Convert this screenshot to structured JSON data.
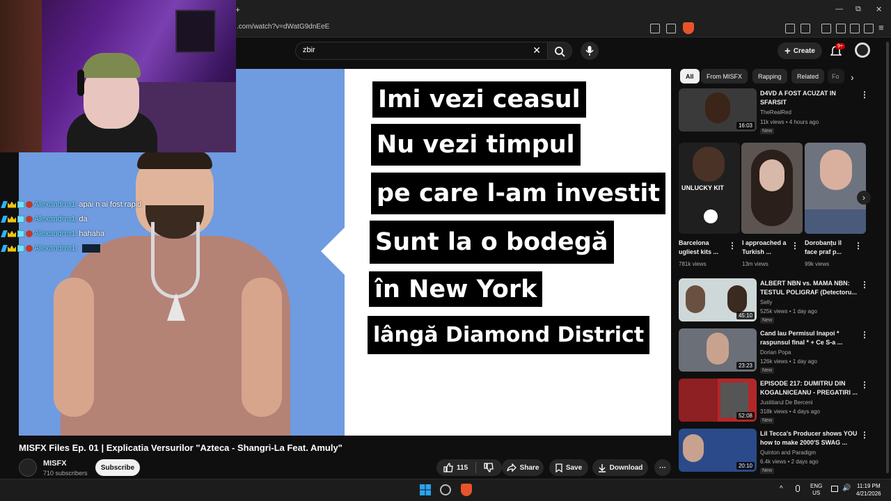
{
  "browser": {
    "url": ".com/watch?v=dWatG9dnEeE",
    "new_tab": "+",
    "minimize": "—",
    "maximize": "⧉",
    "close": "✕"
  },
  "header": {
    "search_value": "zbir",
    "create_label": "Create",
    "notif_count": "9+"
  },
  "chat": [
    {
      "user": "Alexandrra1:",
      "msg": "apai n ai fost rapid"
    },
    {
      "user": "Alexandrra1:",
      "msg": "da"
    },
    {
      "user": "Alexandrra1:",
      "msg": "hahaha"
    },
    {
      "user": "Alexandrra1:",
      "msg": ""
    }
  ],
  "video": {
    "lyrics": [
      "Imi vezi ceasul",
      "Nu vezi timpul",
      "pe care l-am investit",
      "Sunt la o bodegă",
      "în New York",
      "lângă Diamond District"
    ],
    "title": "MISFX Files Ep. 01 | Explicatia Versurilor \"Azteca - Shangri-La Feat. Amuly\"",
    "channel": "MISFX",
    "subs": "710 subscribers",
    "subscribe": "Subscribe",
    "likes": "115",
    "share": "Share",
    "save": "Save",
    "download": "Download"
  },
  "chips": [
    "All",
    "From MISFX",
    "Rapping",
    "Related",
    "Fo"
  ],
  "recommended": [
    {
      "title": "D4VD A FOST ACUZAT IN SFARSIT",
      "channel": "TheRealRed",
      "meta": "11k views • 4 hours ago",
      "duration": "16:03",
      "new": "New",
      "color": "#3a3a3a"
    },
    {
      "title": "ALBERT NBN vs. MAMA NBN: TESTUL POLIGRAF (Detectoru...",
      "channel": "Selly",
      "meta": "525k views • 1 day ago",
      "duration": "45:10",
      "new": "New",
      "color": "#cfd8d8"
    },
    {
      "title": "Cand Iau Permisul Inapoi * raspunsul final * + Ce S-a ...",
      "channel": "Dorian Popa",
      "meta": "126k views • 1 day ago",
      "duration": "23:23",
      "new": "New",
      "color": "#6a6f78"
    },
    {
      "title": "EPISODE 217: DUMITRU DIN KOGALNICEANU - PREGATIRI ...",
      "channel": "Justitiarul De Berceni",
      "meta": "318k views • 4 days ago",
      "duration": "52:08",
      "new": "New",
      "color": "#b0282a"
    },
    {
      "title": "Lil Tecca's Producer shows YOU how to make 2000'S SWAG ...",
      "channel": "Quinton and Paradigm",
      "meta": "6.4k views • 2 days ago",
      "duration": "20:10",
      "new": "New",
      "color": "#2a4a8a"
    }
  ],
  "shorts": [
    {
      "title": "Barcelona ugliest kits ...",
      "views": "781k views",
      "overlay": "UNLUCKY KIT"
    },
    {
      "title": "I approached a Turkish ...",
      "views": "13m views",
      "overlay": ""
    },
    {
      "title": "Dorobanțu îl face praf p...",
      "views": "99k views",
      "overlay": ""
    }
  ],
  "taskbar": {
    "lang1": "ENG",
    "lang2": "US",
    "time": "11:19 PM",
    "date": "4/21/2026"
  }
}
